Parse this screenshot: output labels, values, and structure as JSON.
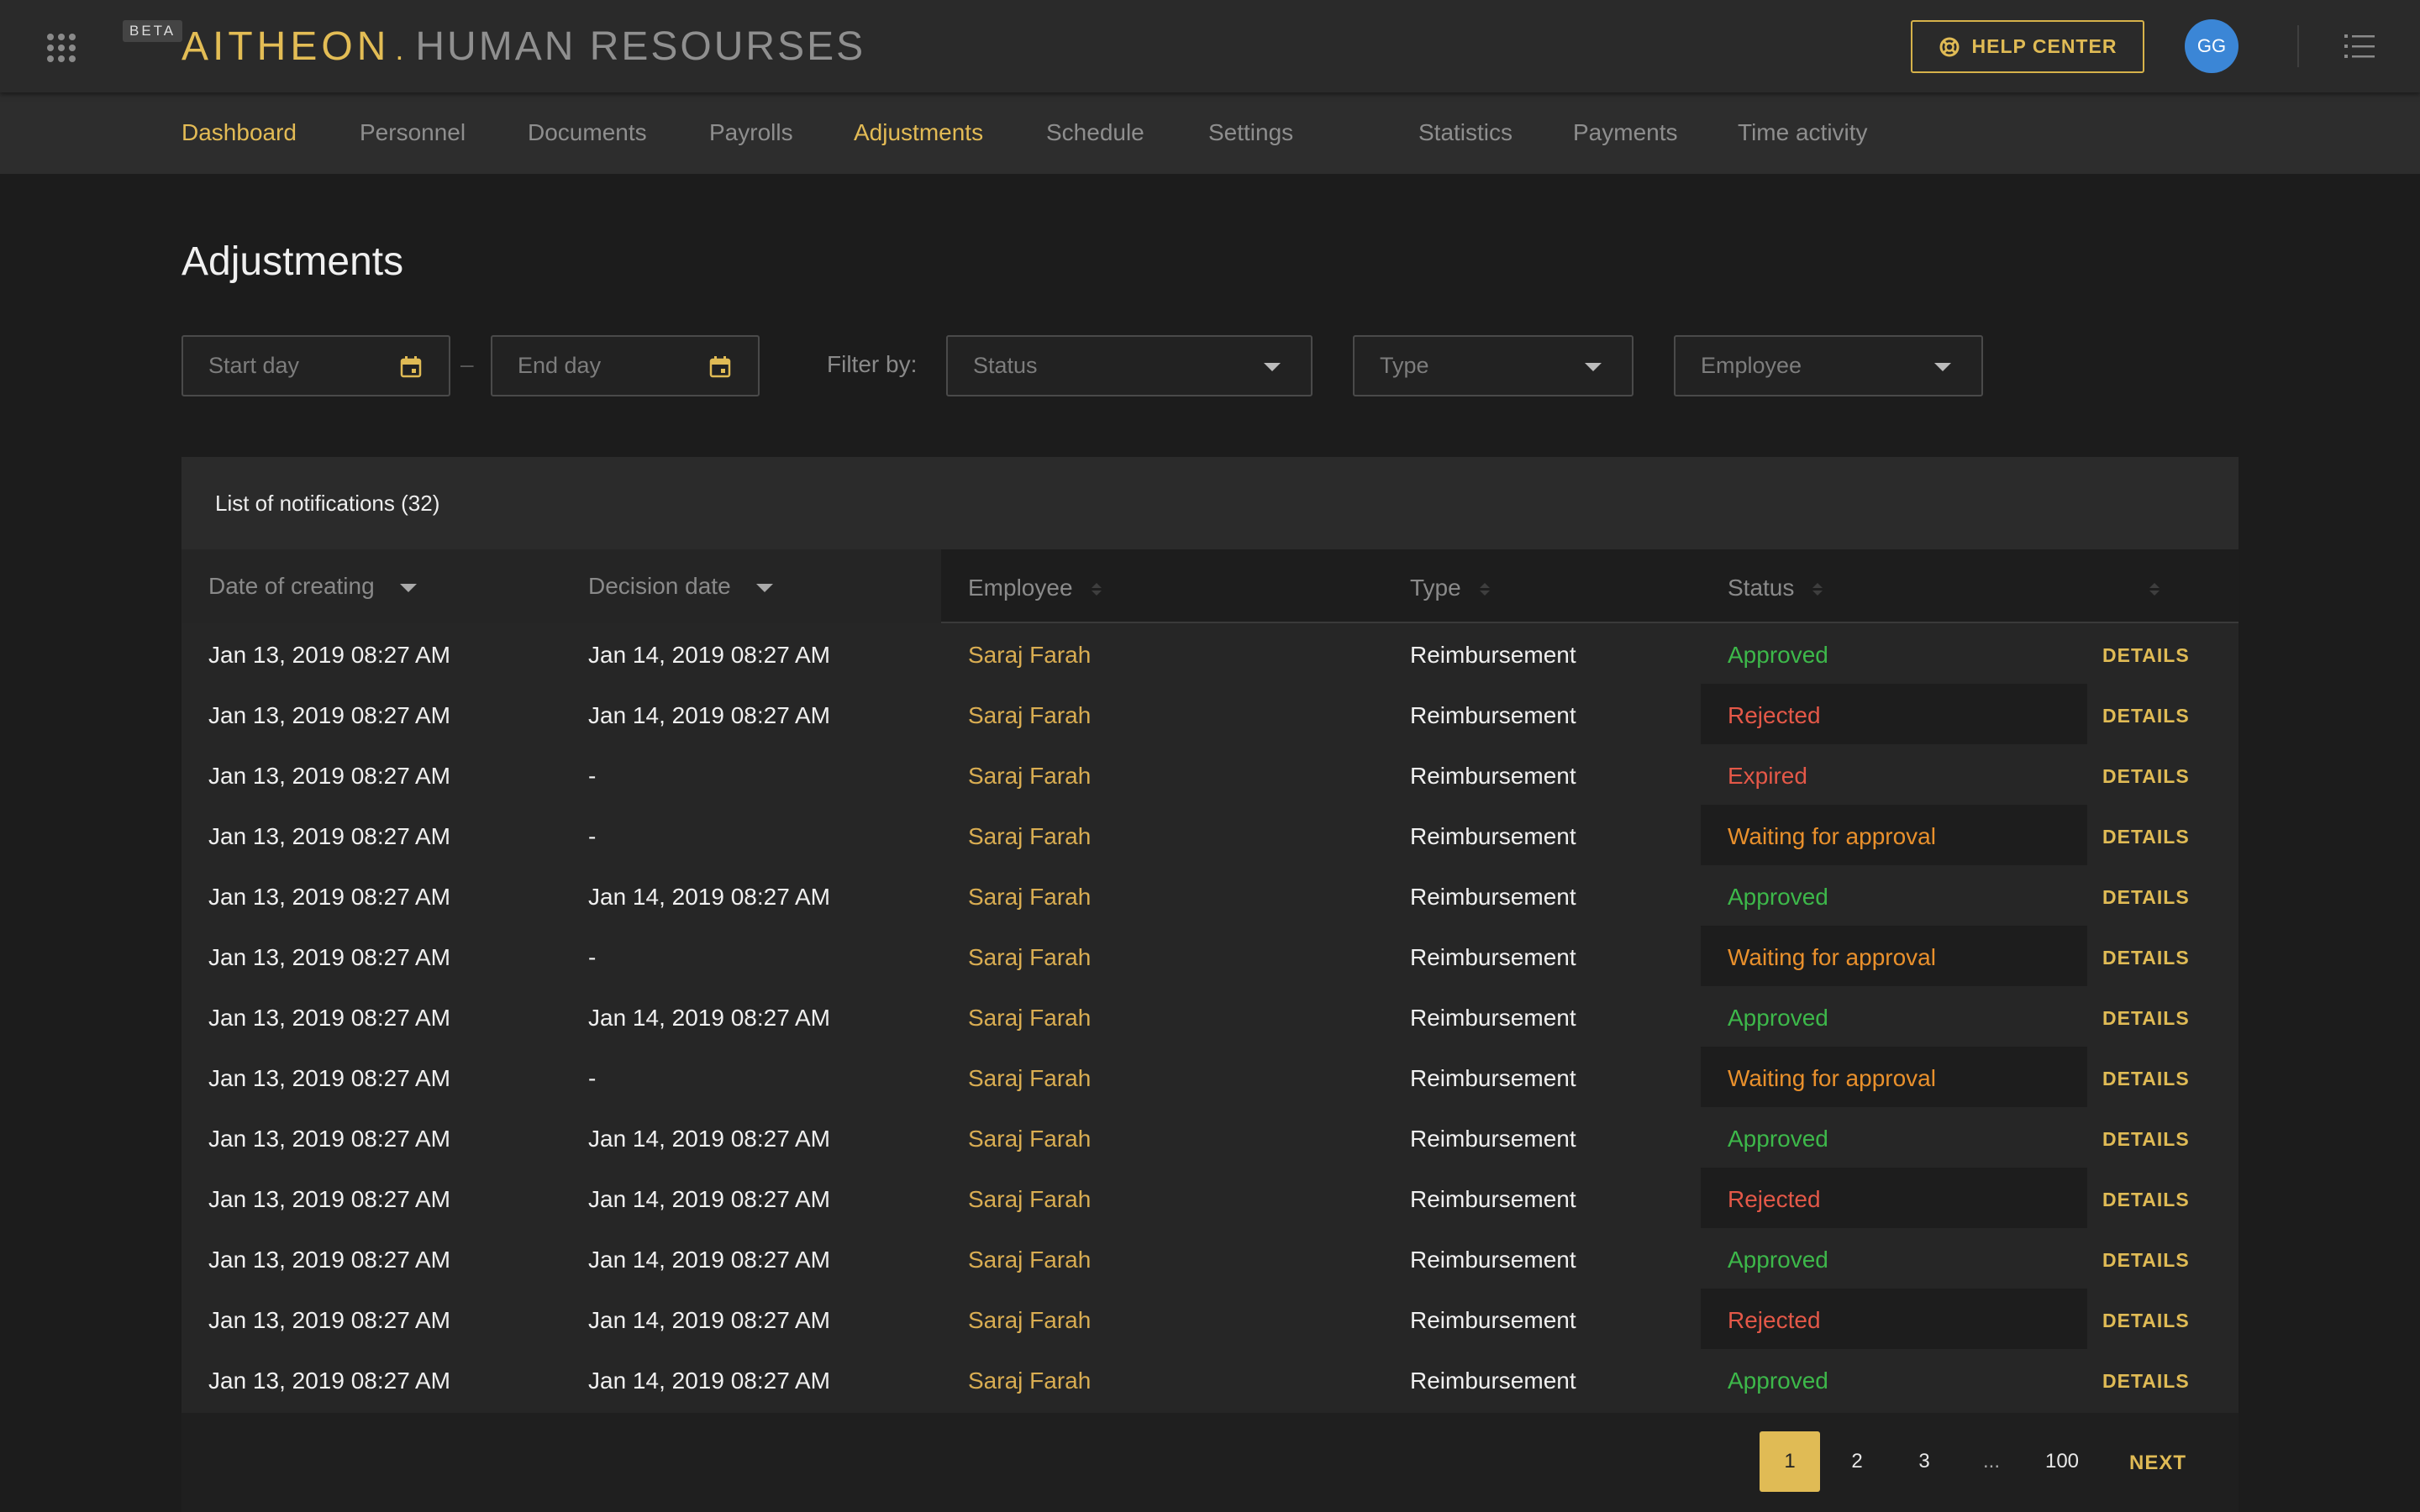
{
  "header": {
    "beta_label": "BETA",
    "brand": "AITHEON",
    "separator": ".",
    "section": "HUMAN RESOURSES",
    "help_label": "HELP CENTER",
    "avatar_initials": "GG",
    "accent_color": "#e3bb55"
  },
  "nav": {
    "items": [
      {
        "label": "Dashboard",
        "active": true
      },
      {
        "label": "Personnel",
        "active": false
      },
      {
        "label": "Documents",
        "active": false
      },
      {
        "label": "Payrolls",
        "active": false
      },
      {
        "label": "Adjustments",
        "active": true
      },
      {
        "label": "Schedule",
        "active": false
      },
      {
        "label": "Settings",
        "active": false
      },
      {
        "label": "Statistics",
        "active": false
      },
      {
        "label": "Payments",
        "active": false
      },
      {
        "label": "Time activity",
        "active": false
      }
    ]
  },
  "page": {
    "title": "Adjustments"
  },
  "filters": {
    "start_placeholder": "Start day",
    "range_dash": "–",
    "end_placeholder": "End day",
    "filter_by_label": "Filter by:",
    "status_select": "Status",
    "type_select": "Type",
    "employee_select": "Employee"
  },
  "table": {
    "title": "List of notifications (32)",
    "columns": {
      "date_created": "Date of creating",
      "decision_date": "Decision date",
      "employee": "Employee",
      "type": "Type",
      "status": "Status"
    },
    "details_label": "DETAILS",
    "rows": [
      {
        "created": "Jan 13, 2019 08:27 AM",
        "decision": "Jan 14, 2019 08:27 AM",
        "employee": "Saraj Farah",
        "type": "Reimbursement",
        "status": "Approved",
        "status_kind": "approved",
        "highlight": false
      },
      {
        "created": "Jan 13, 2019 08:27 AM",
        "decision": "Jan 14, 2019 08:27 AM",
        "employee": "Saraj Farah",
        "type": "Reimbursement",
        "status": "Rejected",
        "status_kind": "rejected",
        "highlight": true
      },
      {
        "created": "Jan 13, 2019 08:27 AM",
        "decision": "-",
        "employee": "Saraj Farah",
        "type": "Reimbursement",
        "status": "Expired",
        "status_kind": "expired",
        "highlight": false
      },
      {
        "created": "Jan 13, 2019 08:27 AM",
        "decision": "-",
        "employee": "Saraj Farah",
        "type": "Reimbursement",
        "status": "Waiting for approval",
        "status_kind": "waiting",
        "highlight": true
      },
      {
        "created": "Jan 13, 2019 08:27 AM",
        "decision": "Jan 14, 2019 08:27 AM",
        "employee": "Saraj Farah",
        "type": "Reimbursement",
        "status": "Approved",
        "status_kind": "approved",
        "highlight": false
      },
      {
        "created": "Jan 13, 2019 08:27 AM",
        "decision": "-",
        "employee": "Saraj Farah",
        "type": "Reimbursement",
        "status": "Waiting for approval",
        "status_kind": "waiting",
        "highlight": true
      },
      {
        "created": "Jan 13, 2019 08:27 AM",
        "decision": "Jan 14, 2019 08:27 AM",
        "employee": "Saraj Farah",
        "type": "Reimbursement",
        "status": "Approved",
        "status_kind": "approved",
        "highlight": false
      },
      {
        "created": "Jan 13, 2019 08:27 AM",
        "decision": "-",
        "employee": "Saraj Farah",
        "type": "Reimbursement",
        "status": "Waiting for approval",
        "status_kind": "waiting",
        "highlight": true
      },
      {
        "created": "Jan 13, 2019 08:27 AM",
        "decision": "Jan 14, 2019 08:27 AM",
        "employee": "Saraj Farah",
        "type": "Reimbursement",
        "status": "Approved",
        "status_kind": "approved",
        "highlight": false
      },
      {
        "created": "Jan 13, 2019 08:27 AM",
        "decision": "Jan 14, 2019 08:27 AM",
        "employee": "Saraj Farah",
        "type": "Reimbursement",
        "status": "Rejected",
        "status_kind": "rejected",
        "highlight": true
      },
      {
        "created": "Jan 13, 2019 08:27 AM",
        "decision": "Jan 14, 2019 08:27 AM",
        "employee": "Saraj Farah",
        "type": "Reimbursement",
        "status": "Approved",
        "status_kind": "approved",
        "highlight": false
      },
      {
        "created": "Jan 13, 2019 08:27 AM",
        "decision": "Jan 14, 2019 08:27 AM",
        "employee": "Saraj Farah",
        "type": "Reimbursement",
        "status": "Rejected",
        "status_kind": "rejected",
        "highlight": true
      },
      {
        "created": "Jan 13, 2019 08:27 AM",
        "decision": "Jan 14, 2019 08:27 AM",
        "employee": "Saraj Farah",
        "type": "Reimbursement",
        "status": "Approved",
        "status_kind": "approved",
        "highlight": false
      }
    ]
  },
  "pagination": {
    "pages": [
      "1",
      "2",
      "3",
      "...",
      "100"
    ],
    "current": "1",
    "next_label": "NEXT"
  },
  "status_colors": {
    "approved": "#3db84a",
    "rejected": "#e45848",
    "expired": "#e45848",
    "waiting": "#e9902c"
  }
}
